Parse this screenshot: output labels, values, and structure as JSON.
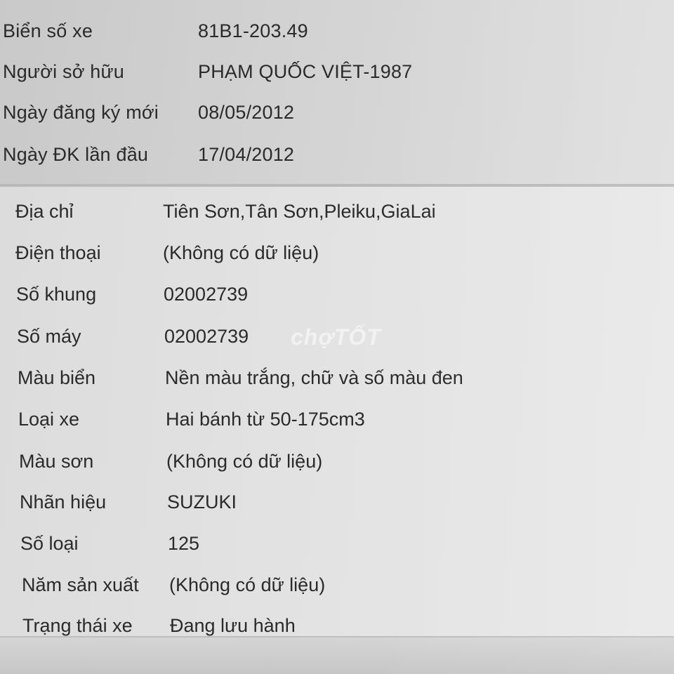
{
  "vehicle_header": [
    {
      "label": "Biển số xe",
      "value": "81B1-203.49"
    },
    {
      "label": "Người sở hữu",
      "value": "PHẠM QUỐC VIỆT-1987"
    },
    {
      "label": "Ngày đăng ký mới",
      "value": "08/05/2012"
    },
    {
      "label": "Ngày ĐK lần đầu",
      "value": "17/04/2012"
    }
  ],
  "details": [
    {
      "label": "Địa chỉ",
      "value": "Tiên Sơn,Tân Sơn,Pleiku,GiaLai"
    },
    {
      "label": "Điện thoại",
      "value": "(Không có dữ liệu)"
    },
    {
      "label": "Số khung",
      "value": "02002739"
    },
    {
      "label": "Số máy",
      "value": "02002739"
    },
    {
      "label": "Màu biển",
      "value": "Nền màu trắng, chữ và số màu đen"
    },
    {
      "label": "Loại xe",
      "value": "Hai bánh từ 50-175cm3"
    },
    {
      "label": "Màu sơn",
      "value": "(Không có dữ liệu)"
    },
    {
      "label": "Nhãn hiệu",
      "value": "SUZUKI"
    },
    {
      "label": "Số loại",
      "value": "125"
    },
    {
      "label": "Năm sản xuất",
      "value": "(Không có dữ liệu)"
    },
    {
      "label": "Trạng thái xe",
      "value": "Đang lưu hành"
    }
  ],
  "watermark": "chợTỐT"
}
